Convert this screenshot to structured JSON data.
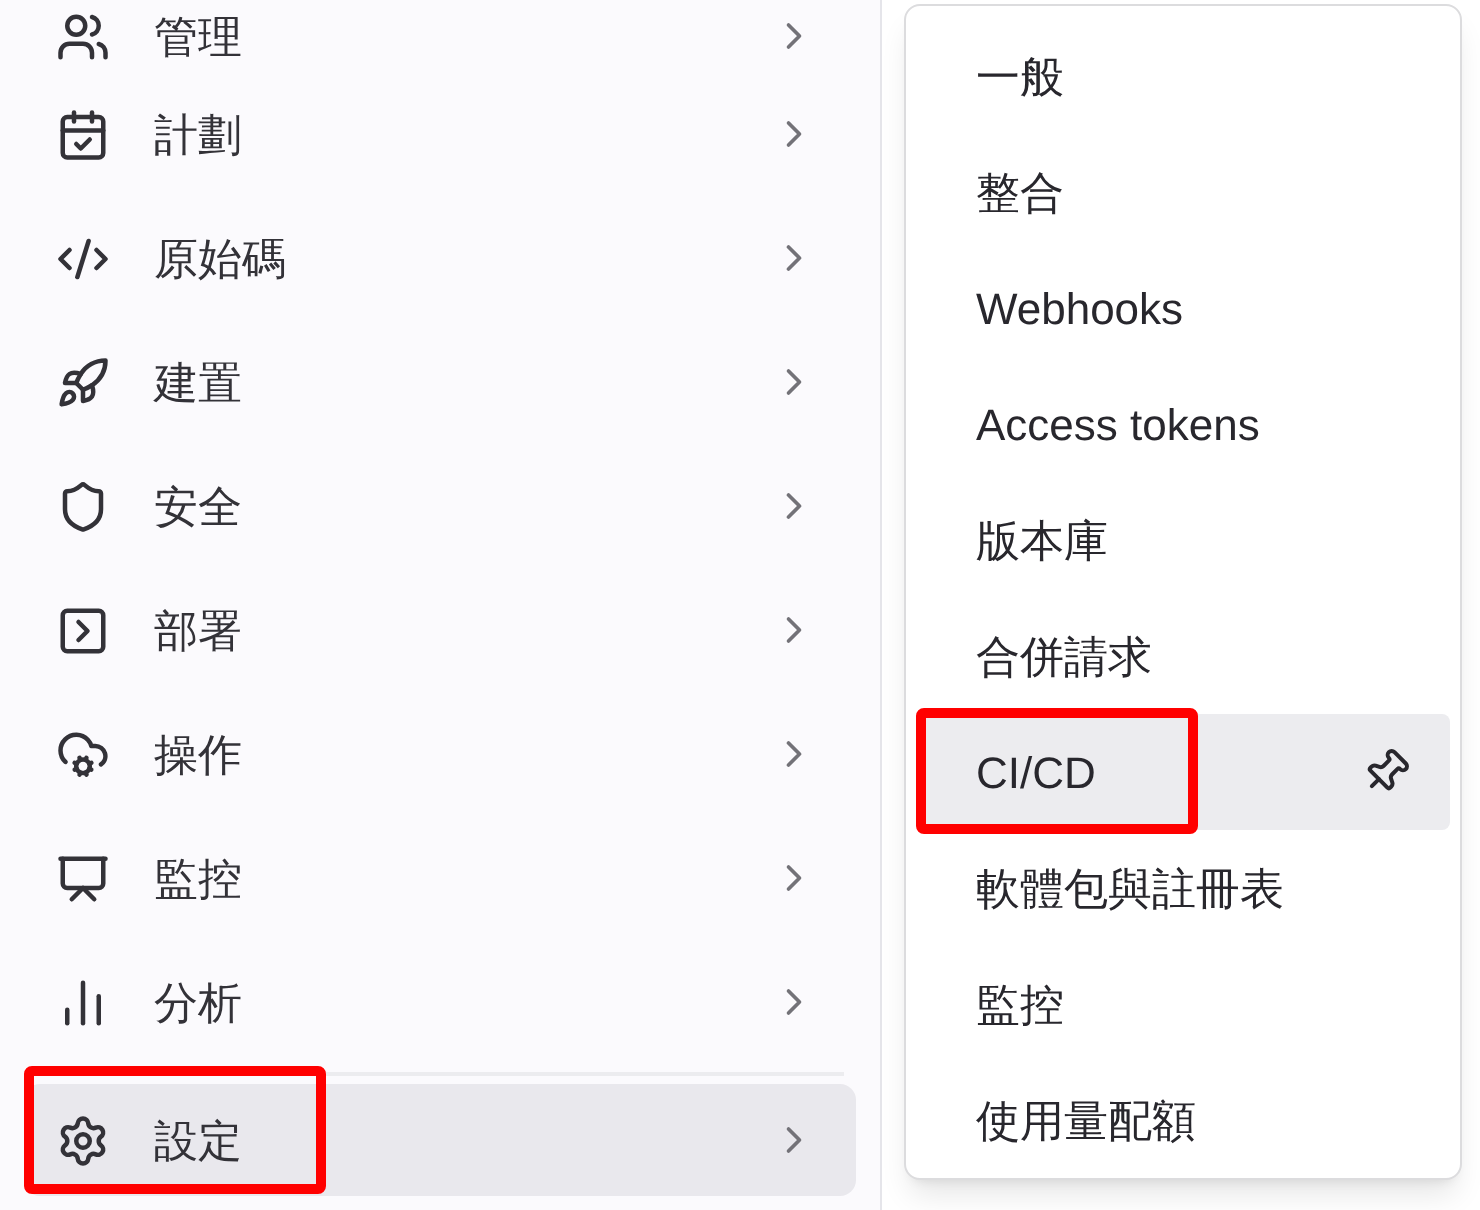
{
  "sidebar": {
    "items": [
      {
        "label": "管理",
        "selected": false,
        "highlighted": false
      },
      {
        "label": "計劃",
        "selected": false,
        "highlighted": false
      },
      {
        "label": "原始碼",
        "selected": false,
        "highlighted": false
      },
      {
        "label": "建置",
        "selected": false,
        "highlighted": false
      },
      {
        "label": "安全",
        "selected": false,
        "highlighted": false
      },
      {
        "label": "部署",
        "selected": false,
        "highlighted": false
      },
      {
        "label": "操作",
        "selected": false,
        "highlighted": false
      },
      {
        "label": "監控",
        "selected": false,
        "highlighted": false
      },
      {
        "label": "分析",
        "selected": false,
        "highlighted": false
      },
      {
        "label": "設定",
        "selected": true,
        "highlighted": true
      }
    ]
  },
  "flyout_menu": {
    "items": [
      {
        "label": "一般",
        "selected": false,
        "highlighted": false
      },
      {
        "label": "整合",
        "selected": false,
        "highlighted": false
      },
      {
        "label": "Webhooks",
        "selected": false,
        "highlighted": false
      },
      {
        "label": "Access tokens",
        "selected": false,
        "highlighted": false
      },
      {
        "label": "版本庫",
        "selected": false,
        "highlighted": false
      },
      {
        "label": "合併請求",
        "selected": false,
        "highlighted": false
      },
      {
        "label": "CI/CD",
        "selected": true,
        "highlighted": true
      },
      {
        "label": "軟體包與註冊表",
        "selected": false,
        "highlighted": false
      },
      {
        "label": "監控",
        "selected": false,
        "highlighted": false
      },
      {
        "label": "使用量配額",
        "selected": false,
        "highlighted": false
      }
    ]
  }
}
